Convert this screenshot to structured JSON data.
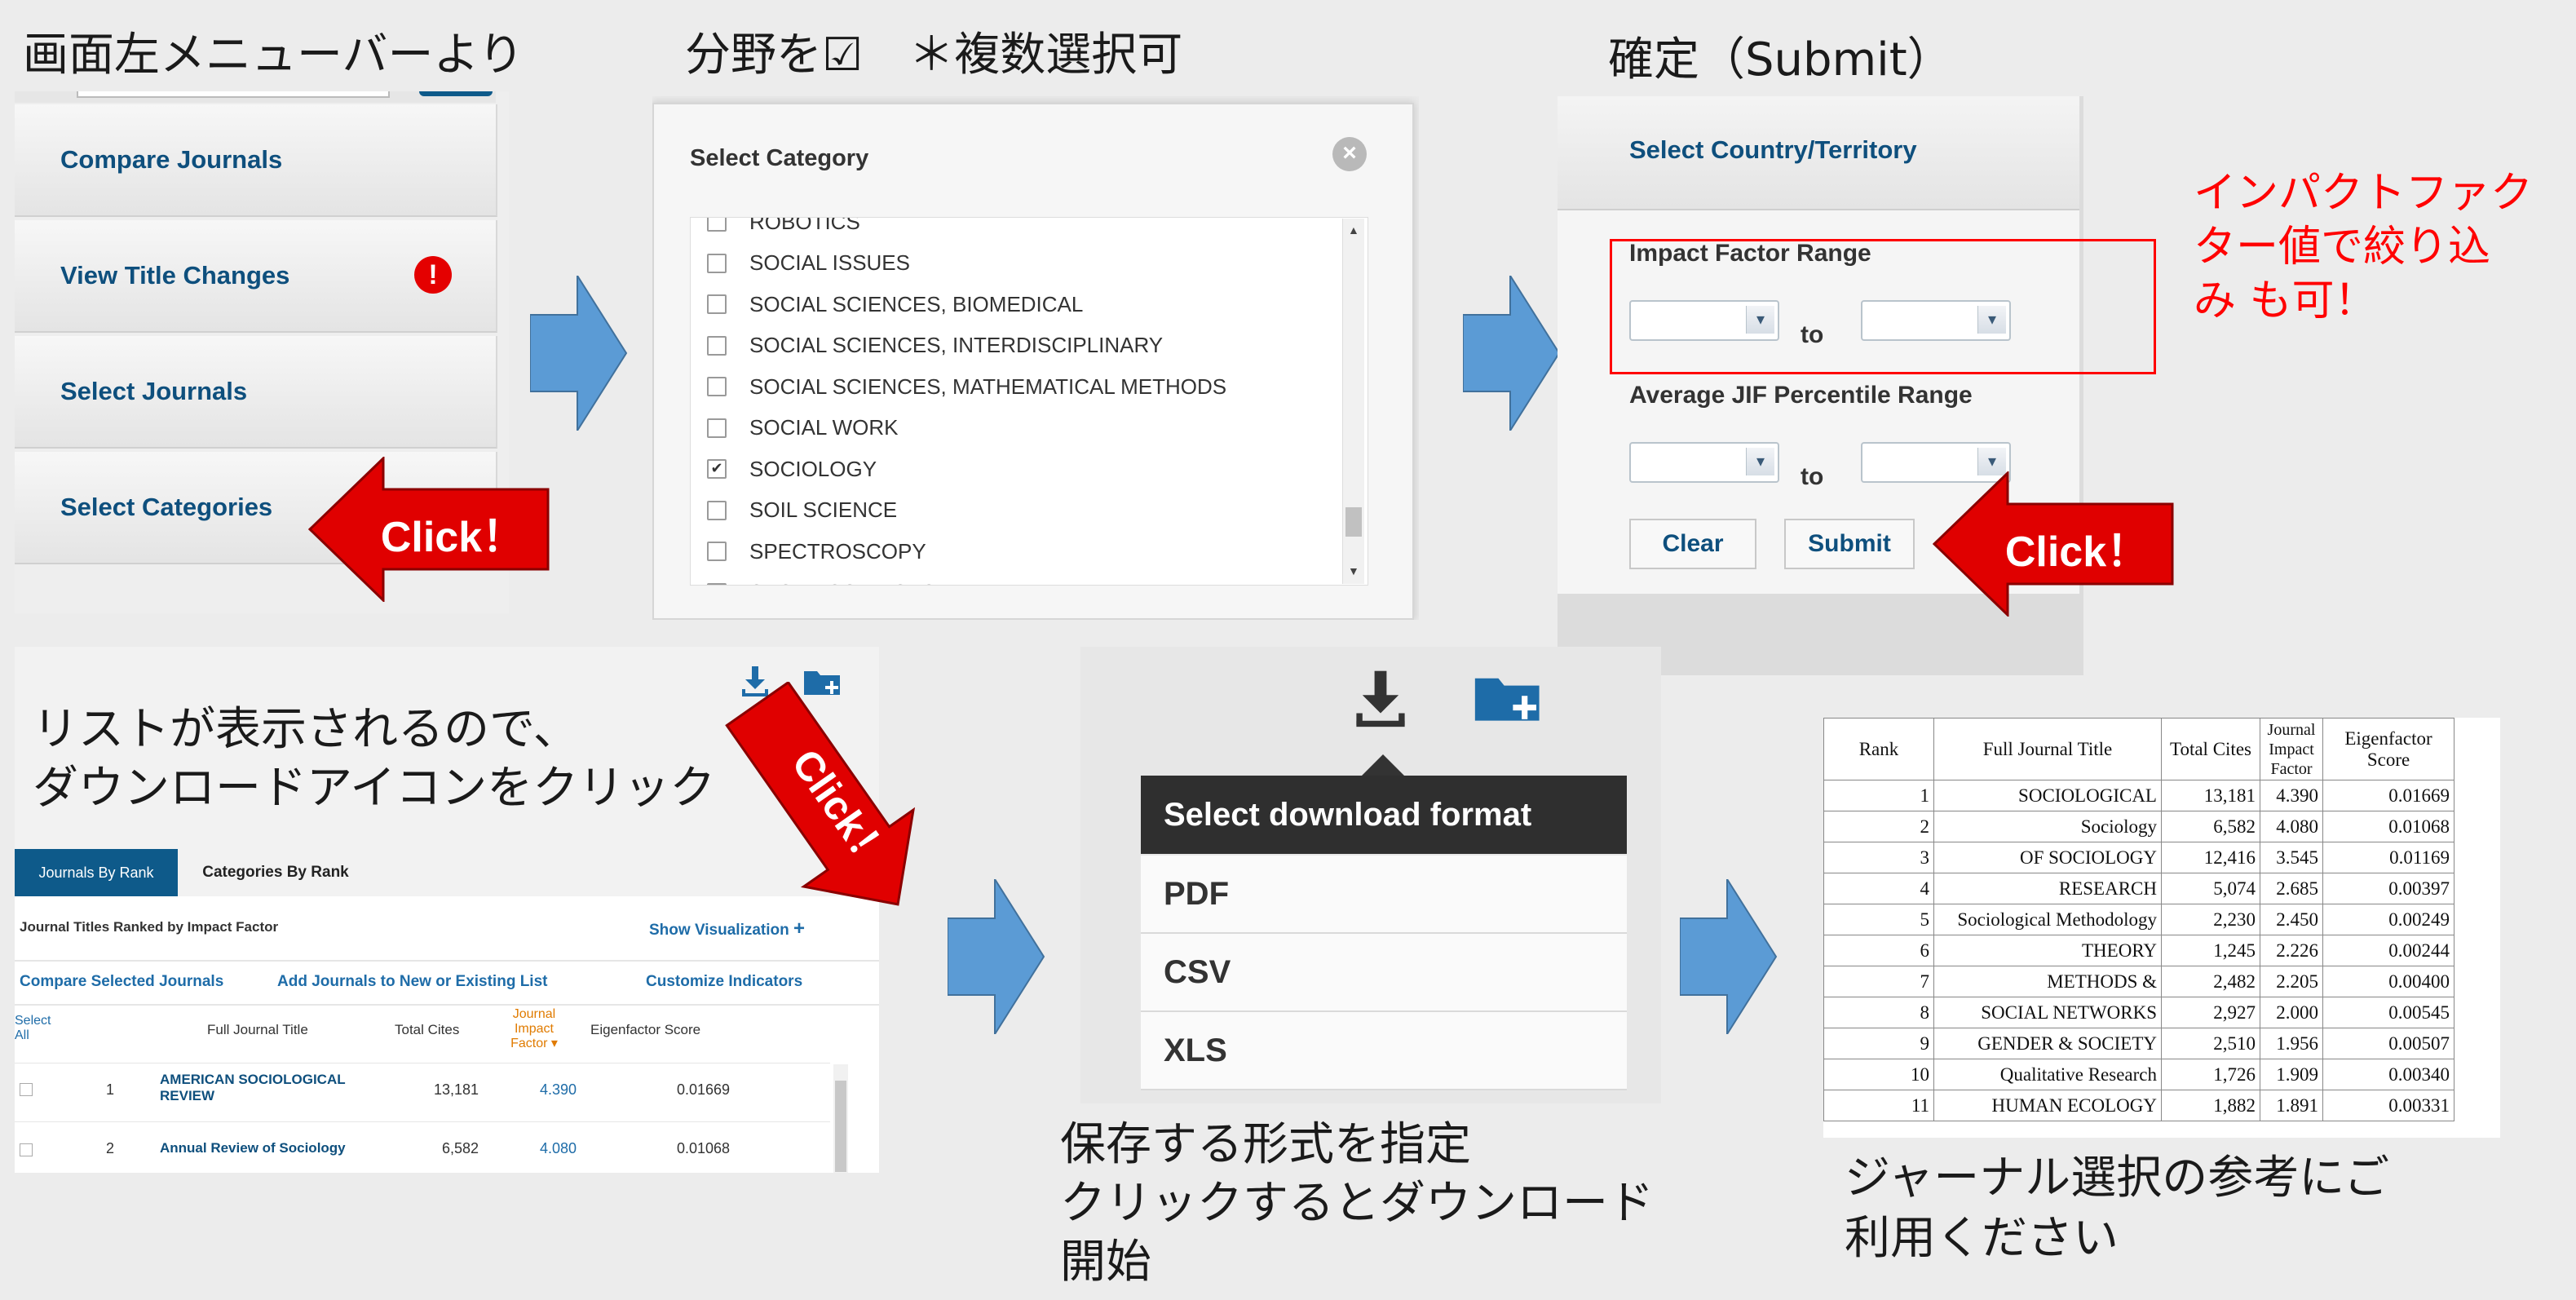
{
  "captions": {
    "step1": "画面左メニューバーより",
    "step2": "分野を☑　＊複数選択可",
    "step3": "確定（Submit）",
    "impact_note": [
      "インパクトファク",
      "ター値で絞り込",
      "み も可！"
    ],
    "step4": [
      "リストが表示されるので、",
      "ダウンロードアイコンをクリック"
    ],
    "step5": [
      "保存する形式を指定",
      "クリックするとダウンロード",
      "開始"
    ],
    "step6": [
      "ジャーナル選択の参考にご",
      "利用ください"
    ]
  },
  "click_label": "Click！",
  "menu": {
    "items": [
      {
        "label": "Compare Journals"
      },
      {
        "label": "View Title Changes"
      },
      {
        "label": "Select Journals"
      },
      {
        "label": "Select Categories"
      }
    ]
  },
  "category_modal": {
    "title": "Select Category",
    "items": [
      {
        "label": "ROBOTICS",
        "checked": false
      },
      {
        "label": "SOCIAL ISSUES",
        "checked": false
      },
      {
        "label": "SOCIAL SCIENCES, BIOMEDICAL",
        "checked": false
      },
      {
        "label": "SOCIAL SCIENCES, INTERDISCIPLINARY",
        "checked": false
      },
      {
        "label": "SOCIAL SCIENCES, MATHEMATICAL METHODS",
        "checked": false
      },
      {
        "label": "SOCIAL WORK",
        "checked": false
      },
      {
        "label": "SOCIOLOGY",
        "checked": true
      },
      {
        "label": "SOIL SCIENCE",
        "checked": false
      },
      {
        "label": "SPECTROSCOPY",
        "checked": false
      },
      {
        "label": "SPORT SCIENCES",
        "checked": false
      }
    ]
  },
  "filter_panel": {
    "country_label": "Select Country/Territory",
    "impact_label": "Impact Factor Range",
    "jif_label": "Average JIF Percentile Range",
    "to": "to",
    "clear": "Clear",
    "submit": "Submit"
  },
  "results_panel": {
    "tabs": [
      "Journals By Rank",
      "Categories By Rank"
    ],
    "subtitle": "Journal Titles Ranked by Impact Factor",
    "show_vis": "Show Visualization",
    "compare": "Compare Selected Journals",
    "add_to_list": "Add Journals to New or Existing List",
    "customize": "Customize Indicators",
    "columns": {
      "select": "Select",
      "all": "All",
      "title": "Full Journal Title",
      "cites": "Total Cites",
      "jif": [
        "Journal",
        "Impact",
        "Factor"
      ],
      "eigen": "Eigenfactor Score"
    },
    "rows": [
      {
        "rank": "1",
        "title": [
          "AMERICAN SOCIOLOGICAL",
          "REVIEW"
        ],
        "cites": "13,181",
        "jif": "4.390",
        "eigen": "0.01669"
      },
      {
        "rank": "2",
        "title": [
          "Annual Review of Sociology"
        ],
        "cites": "6,582",
        "jif": "4.080",
        "eigen": "0.01068"
      }
    ]
  },
  "download_menu": {
    "title": "Select download format",
    "options": [
      "PDF",
      "CSV",
      "XLS"
    ]
  },
  "excel_table": {
    "headers": [
      "Rank",
      "Full Journal Title",
      "Total Cites",
      "Journal Impact Factor",
      "Eigenfactor Score"
    ],
    "rows": [
      [
        "1",
        "SOCIOLOGICAL",
        "13,181",
        "4.390",
        "0.01669"
      ],
      [
        "2",
        "Sociology",
        "6,582",
        "4.080",
        "0.01068"
      ],
      [
        "3",
        "OF SOCIOLOGY",
        "12,416",
        "3.545",
        "0.01169"
      ],
      [
        "4",
        "RESEARCH",
        "5,074",
        "2.685",
        "0.00397"
      ],
      [
        "5",
        "Sociological Methodology",
        "2,230",
        "2.450",
        "0.00249"
      ],
      [
        "6",
        "THEORY",
        "1,245",
        "2.226",
        "0.00244"
      ],
      [
        "7",
        "METHODS &",
        "2,482",
        "2.205",
        "0.00400"
      ],
      [
        "8",
        "SOCIAL NETWORKS",
        "2,927",
        "2.000",
        "0.00545"
      ],
      [
        "9",
        "GENDER & SOCIETY",
        "2,510",
        "1.956",
        "0.00507"
      ],
      [
        "10",
        "Qualitative Research",
        "1,726",
        "1.909",
        "0.00340"
      ],
      [
        "11",
        "HUMAN ECOLOGY",
        "1,882",
        "1.891",
        "0.00331"
      ]
    ]
  },
  "colors": {
    "click_red": "#e00000",
    "arrow_blue": "#5b9bd5",
    "link_blue": "#0e4f7d",
    "note_red": "#ff0000"
  }
}
